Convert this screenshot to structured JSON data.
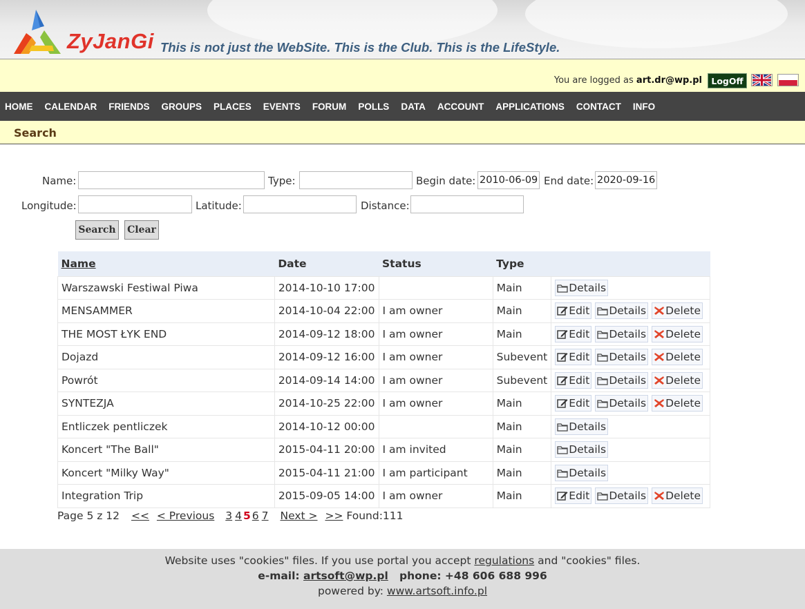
{
  "brand": {
    "name": "ZyJanGi",
    "tagline": "This is not just the WebSite. This is the Club. This is the LifeStyle."
  },
  "login": {
    "prefix": "You are logged as",
    "user": "art.dr@wp.pl",
    "logoff_label": "LogOff"
  },
  "nav": [
    "HOME",
    "CALENDAR",
    "FRIENDS",
    "GROUPS",
    "PLACES",
    "EVENTS",
    "FORUM",
    "POLLS",
    "DATA",
    "ACCOUNT",
    "APPLICATIONS",
    "CONTACT",
    "INFO"
  ],
  "section": {
    "title": "Search"
  },
  "form": {
    "name_label": "Name:",
    "name_value": "",
    "type_label": "Type:",
    "type_value": "",
    "begin_label": "Begin date:",
    "begin_value": "2010-06-09",
    "end_label": "End date:",
    "end_value": "2020-09-16",
    "lon_label": "Longitude:",
    "lon_value": "",
    "lat_label": "Latitude:",
    "lat_value": "",
    "dist_label": "Distance:",
    "dist_value": "",
    "search_label": "Search",
    "clear_label": "Clear"
  },
  "table": {
    "headers": {
      "name": "Name",
      "date": "Date",
      "status": "Status",
      "type": "Type"
    },
    "actions": {
      "edit": "Edit",
      "details": "Details",
      "delete": "Delete"
    },
    "rows": [
      {
        "name": "Warszawski Festiwal Piwa",
        "date": "2014-10-10 17:00",
        "status": "",
        "type": "Main",
        "owner": false
      },
      {
        "name": "MENSAMMER",
        "date": "2014-10-04 22:00",
        "status": "I am owner",
        "type": "Main",
        "owner": true
      },
      {
        "name": "THE MOST ŁYK END",
        "date": "2014-09-12 18:00",
        "status": "I am owner",
        "type": "Main",
        "owner": true
      },
      {
        "name": "Dojazd",
        "date": "2014-09-12 16:00",
        "status": "I am owner",
        "type": "Subevent",
        "owner": true
      },
      {
        "name": "Powrót",
        "date": "2014-09-14 14:00",
        "status": "I am owner",
        "type": "Subevent",
        "owner": true
      },
      {
        "name": "SYNTEZJA",
        "date": "2014-10-25 22:00",
        "status": "I am owner",
        "type": "Main",
        "owner": true
      },
      {
        "name": "Entliczek pentliczek",
        "date": "2014-10-12 00:00",
        "status": "",
        "type": "Main",
        "owner": false
      },
      {
        "name": "Koncert \"The Ball\"",
        "date": "2015-04-11 20:00",
        "status": "I am invited",
        "type": "Main",
        "owner": false
      },
      {
        "name": "Koncert \"Milky Way\"",
        "date": "2015-04-11 21:00",
        "status": "I am participant",
        "type": "Main",
        "owner": false
      },
      {
        "name": "Integration Trip",
        "date": "2015-09-05 14:00",
        "status": "I am owner",
        "type": "Main",
        "owner": true
      }
    ]
  },
  "pager": {
    "page_text": "Page 5 z 12",
    "first": "<<",
    "prev": "< Previous",
    "pages_before": [
      "3",
      "4"
    ],
    "current": "5",
    "pages_after": [
      "6",
      "7"
    ],
    "next": "Next >",
    "last": ">>",
    "found": "Found:111"
  },
  "footer": {
    "cookie_prefix": "Website uses \"cookies\" files. If you use portal you accept",
    "regulations": "regulations",
    "cookie_suffix": "and \"cookies\" files.",
    "email_label": "e-mail:",
    "email": "artsoft@wp.pl",
    "phone": "phone: +48 606 688 996",
    "powered_label": "powered by:",
    "powered_link": "www.artsoft.info.pl"
  },
  "colors": {
    "nav_bg": "#444444",
    "bar_bg": "#ffffcc",
    "brand_red": "#e0332a",
    "tagline_blue": "#3d5f80",
    "logoff_bg": "#123d14",
    "current_page": "#d0021b"
  }
}
